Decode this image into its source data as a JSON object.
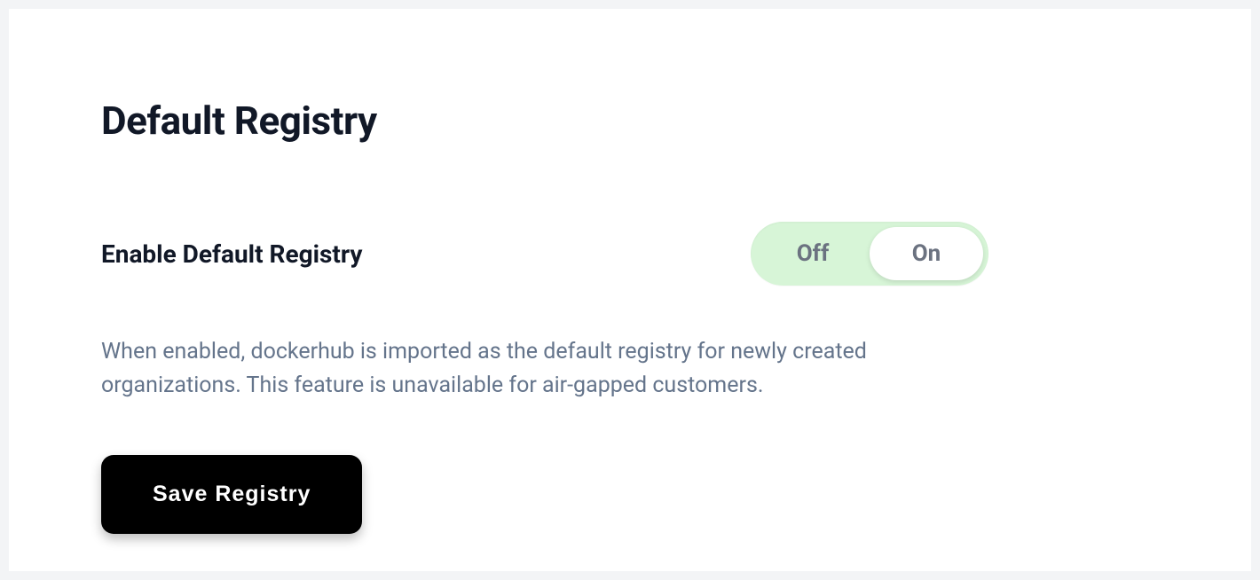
{
  "page": {
    "title": "Default Registry"
  },
  "setting": {
    "label": "Enable Default Registry",
    "toggle": {
      "off_label": "Off",
      "on_label": "On",
      "value": "on"
    },
    "description": "When enabled, dockerhub is imported as the default registry for newly created organizations. This feature is unavailable for air-gapped customers."
  },
  "actions": {
    "save_label": "Save Registry"
  }
}
